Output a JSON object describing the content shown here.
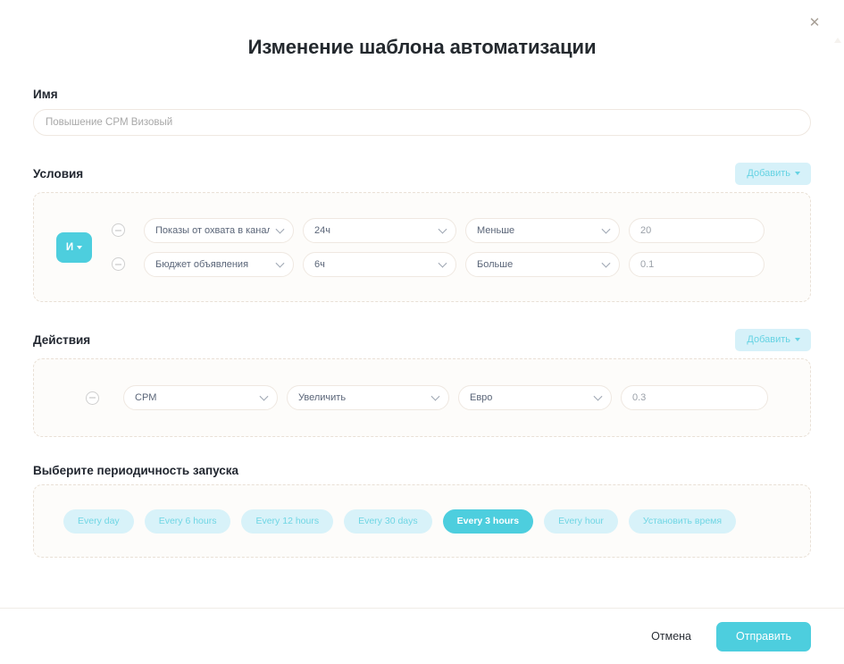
{
  "modal": {
    "title": "Изменение шаблона автоматизации",
    "close_icon": "close-icon"
  },
  "name_section": {
    "label": "Имя",
    "value": "",
    "placeholder": "Повышение CPM Визовый"
  },
  "conditions_section": {
    "label": "Условия",
    "add_label": "Добавить",
    "logic_operator": "И",
    "rows": [
      {
        "metric": "Показы от охвата в канале",
        "period": "24ч",
        "operator": "Меньше",
        "value": "",
        "value_placeholder": "20"
      },
      {
        "metric": "Бюджет объявления",
        "period": "6ч",
        "operator": "Больше",
        "value": "",
        "value_placeholder": "0.1"
      }
    ]
  },
  "actions_section": {
    "label": "Действия",
    "add_label": "Добавить",
    "rows": [
      {
        "target": "CPM",
        "operation": "Увеличить",
        "currency": "Евро",
        "value": "",
        "value_placeholder": "0.3"
      }
    ]
  },
  "schedule_section": {
    "label": "Выберите периодичность запуска",
    "chips": [
      {
        "label": "Every day",
        "active": false
      },
      {
        "label": "Every 6 hours",
        "active": false
      },
      {
        "label": "Every 12 hours",
        "active": false
      },
      {
        "label": "Every 30 days",
        "active": false
      },
      {
        "label": "Every 3 hours",
        "active": true
      },
      {
        "label": "Every hour",
        "active": false
      },
      {
        "label": "Установить время",
        "active": false
      }
    ]
  },
  "footer": {
    "cancel_label": "Отмена",
    "submit_label": "Отправить"
  },
  "colors": {
    "accent": "#4dcede",
    "accent_soft": "#d8f2f9",
    "text": "#222730",
    "muted": "#9aa0a8",
    "border": "#efe8e1",
    "panel_border": "#e9e0d6",
    "panel_bg": "#fdfcfa"
  }
}
